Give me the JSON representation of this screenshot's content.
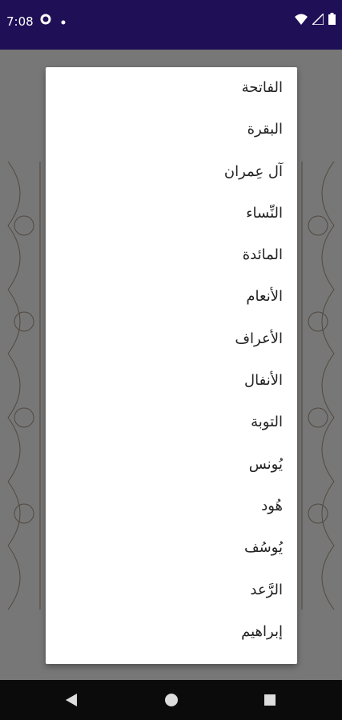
{
  "status_bar": {
    "time": "7:08",
    "left_icons": [
      "gear-icon",
      "dot-icon"
    ],
    "right_icons": [
      "wifi-icon",
      "signal-icon",
      "battery-icon"
    ],
    "background": "#1f0f56"
  },
  "dropdown": {
    "items": [
      "الفاتحة",
      "البقرة",
      "آل عِمران",
      "النِّساء",
      "المائدة",
      "الأنعام",
      "الأعراف",
      "الأنفال",
      "التوبة",
      "يُونس",
      "هُود",
      "يُوسُف",
      "الرَّعد",
      "إبراهيم"
    ]
  },
  "bottom_button": {
    "icon": "chevron-up-icon",
    "color": "#0d6e73"
  },
  "nav_bar": {
    "icons": [
      "back-icon",
      "home-icon",
      "recents-icon"
    ]
  }
}
